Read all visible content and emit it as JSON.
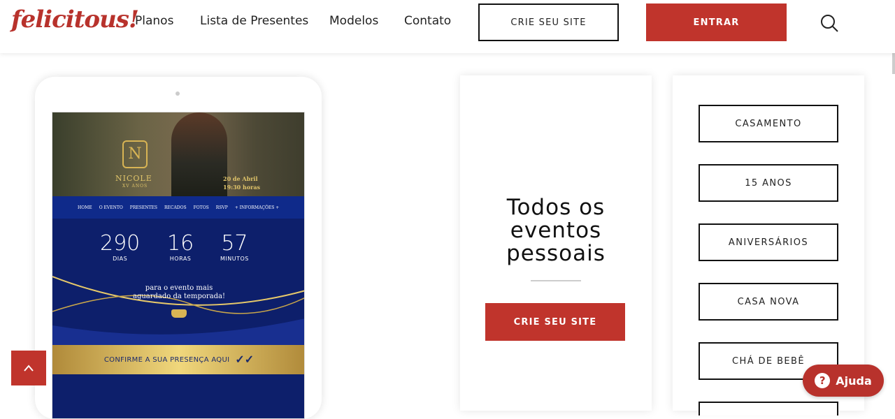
{
  "header": {
    "logo": "felicitous!",
    "nav": [
      "Planos",
      "Lista de Presentes",
      "Modelos",
      "Contato"
    ],
    "cta_create": "CRIE SEU SITE",
    "cta_login": "ENTRAR",
    "search_icon": "search-icon"
  },
  "preview": {
    "hero_name": "NICOLE",
    "hero_sub": "XV ANOS",
    "hero_date": "20 de Abril",
    "hero_time": "19:30 horas",
    "nav": [
      "HOME",
      "O EVENTO",
      "PRESENTES",
      "RECADOS",
      "FOTOS",
      "RSVP",
      "+ INFORMAÇÕES +"
    ],
    "countdown": [
      {
        "value": "290",
        "label": "DIAS"
      },
      {
        "value": "16",
        "label": "HORAS"
      },
      {
        "value": "57",
        "label": "MINUTOS"
      }
    ],
    "tagline_1": "para o evento mais",
    "tagline_2": "aguardado da temporada!",
    "rsvp": "CONFIRME A SUA PRESENÇA AQUI",
    "colors": {
      "navy": "#0d1f6b",
      "gold": "#d8b454"
    }
  },
  "events_card": {
    "title_1": "Todos os",
    "title_2": "eventos",
    "title_3": "pessoais",
    "cta": "CRIE SEU SITE"
  },
  "categories": [
    "CASAMENTO",
    "15 ANOS",
    "ANIVERSÁRIOS",
    "CASA NOVA",
    "CHÁ DE BEBÊ"
  ],
  "help": {
    "label": "Ajuda",
    "icon": "question-icon"
  },
  "scroll_top": {
    "icon": "chevron-up-icon"
  },
  "colors": {
    "brand_red": "#c0342c",
    "text": "#222222"
  }
}
